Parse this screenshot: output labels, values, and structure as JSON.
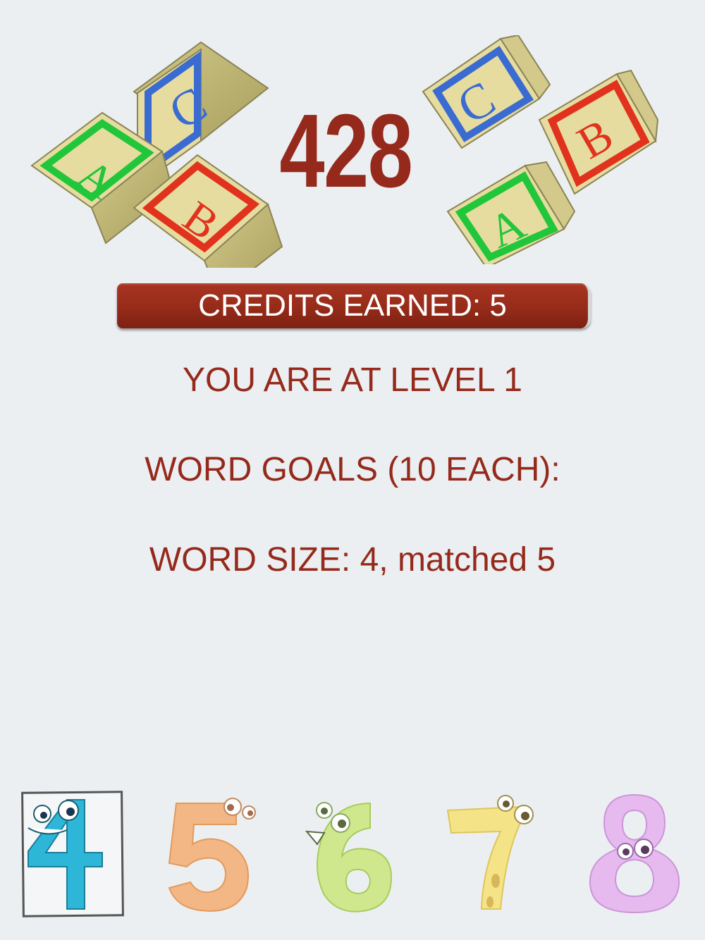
{
  "score": "428",
  "credits_label": "CREDITS EARNED: 5",
  "level_text": "YOU ARE AT LEVEL 1",
  "goals_text": "WORD GOALS (10 EACH):",
  "size_text": "WORD SIZE: 4, matched 5",
  "digits": [
    {
      "label": "4",
      "color": "#2eb6d8",
      "selected": true
    },
    {
      "label": "5",
      "color": "#f2b785",
      "selected": false
    },
    {
      "label": "6",
      "color": "#cfe88e",
      "selected": false
    },
    {
      "label": "7",
      "color": "#f4e487",
      "selected": false
    },
    {
      "label": "8",
      "color": "#e6b9ef",
      "selected": false
    }
  ],
  "block_letters": [
    "A",
    "B",
    "C"
  ],
  "colors": {
    "accent": "#952a1c",
    "background": "#ebeff2",
    "block_face": "#e6dca0",
    "block_green": "#22c63a",
    "block_red": "#e0321c",
    "block_blue": "#3a6bd0"
  }
}
